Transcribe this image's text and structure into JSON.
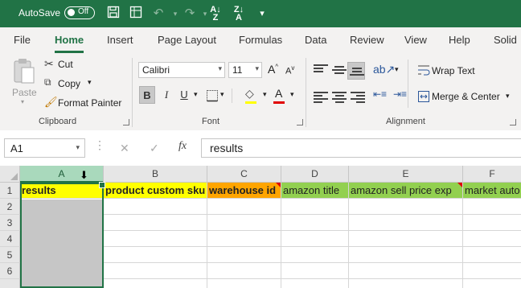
{
  "titlebar": {
    "autosave_label": "AutoSave",
    "autosave_state": "Off"
  },
  "menu": {
    "tabs": [
      "File",
      "Home",
      "Insert",
      "Page Layout",
      "Formulas",
      "Data",
      "Review",
      "View",
      "Help",
      "Solid"
    ],
    "active_tab": "Home"
  },
  "ribbon": {
    "clipboard": {
      "paste": "Paste",
      "cut": "Cut",
      "copy": "Copy",
      "format_painter": "Format Painter",
      "group_label": "Clipboard"
    },
    "font": {
      "font_name": "Calibri",
      "font_size": "11",
      "bold": "B",
      "italic": "I",
      "underline": "U",
      "group_label": "Font",
      "bold_active": true
    },
    "alignment": {
      "wrap_text": "Wrap Text",
      "merge_center": "Merge & Center",
      "group_label": "Alignment"
    }
  },
  "formula_bar": {
    "name_box": "A1",
    "fx": "fx",
    "formula": "results"
  },
  "sheet": {
    "columns": [
      "A",
      "B",
      "C",
      "D",
      "E",
      "F"
    ],
    "selected_column": "A",
    "rows": [
      "1",
      "2",
      "3",
      "4",
      "5",
      "6"
    ],
    "header_row": [
      {
        "col": "A",
        "text": "results",
        "fill": "#ffff00",
        "bold": true,
        "comment": false
      },
      {
        "col": "B",
        "text": "product custom sku",
        "fill": "#ffff00",
        "bold": true,
        "comment": false
      },
      {
        "col": "C",
        "text": "warehouse id",
        "fill": "#ffa500",
        "bold": true,
        "comment": true
      },
      {
        "col": "D",
        "text": "amazon title",
        "fill": "#92d050",
        "bold": false,
        "comment": false
      },
      {
        "col": "E",
        "text": "amazon sell price exp",
        "fill": "#92d050",
        "bold": false,
        "comment": true
      },
      {
        "col": "F",
        "text": "market auto",
        "fill": "#92d050",
        "bold": false,
        "comment": false
      }
    ]
  },
  "colors": {
    "brand": "#217346",
    "selection_fill": "#c6c6c6"
  }
}
